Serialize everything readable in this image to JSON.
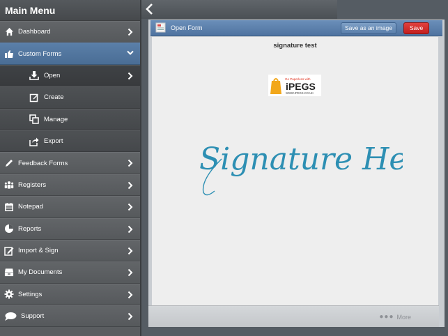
{
  "sidebar": {
    "title": "Main Menu",
    "items": [
      {
        "label": "Dashboard",
        "icon": "home-icon"
      },
      {
        "label": "Custom Forms",
        "icon": "thumbs-up-icon"
      },
      {
        "label": "Open",
        "icon": "download-icon"
      },
      {
        "label": "Create",
        "icon": "edit-icon"
      },
      {
        "label": "Manage",
        "icon": "copy-icon"
      },
      {
        "label": "Export",
        "icon": "share-icon"
      },
      {
        "label": "Feedback Forms",
        "icon": "pencil-icon"
      },
      {
        "label": "Registers",
        "icon": "people-icon"
      },
      {
        "label": "Notepad",
        "icon": "calendar-icon"
      },
      {
        "label": "Reports",
        "icon": "pie-chart-icon"
      },
      {
        "label": "Import & Sign",
        "icon": "sign-icon"
      },
      {
        "label": "My Documents",
        "icon": "drawer-icon"
      },
      {
        "label": "Settings",
        "icon": "gear-icon"
      },
      {
        "label": "Support",
        "icon": "speech-bubble-icon"
      }
    ]
  },
  "form": {
    "header_title": "Open Form",
    "save_image_label": "Save as an image",
    "save_label": "Save",
    "document_title": "signature test",
    "logo_tagline": "Go Paperless with",
    "logo_name": "iPEGS",
    "logo_url": "WWW.IPEGS.CO.UK",
    "signature_text": "Signature Here"
  },
  "footer": {
    "more_label": "More"
  },
  "colors": {
    "accent_blue": "#5a7fab",
    "save_red": "#c41f1f",
    "signature_blue": "#2d8fb3"
  }
}
